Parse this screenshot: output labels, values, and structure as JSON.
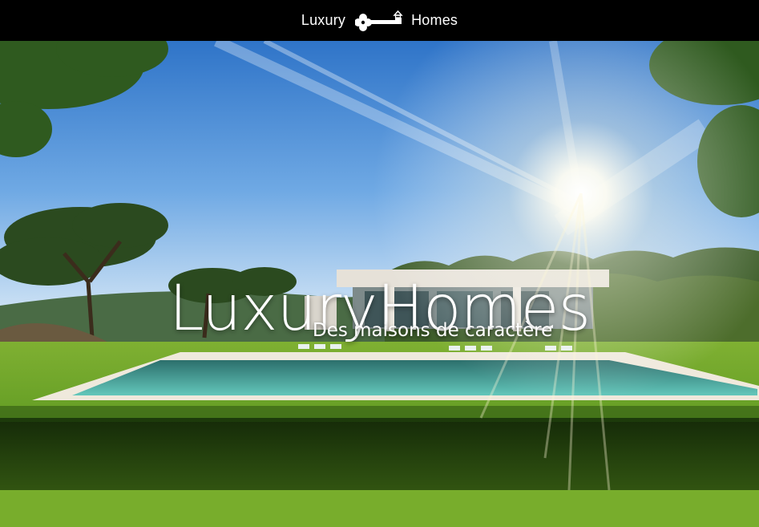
{
  "header": {
    "brand_left": "Luxury",
    "brand_right": "Homes",
    "logo_icon": "key-house-icon"
  },
  "hero": {
    "title": "LuxuryHomes",
    "subtitle": "Des maisons de caractère",
    "background": "villa-with-pool-sunburst-photo"
  },
  "colors": {
    "header_bg": "#000000",
    "text": "#ffffff",
    "sky": "#3f86d6",
    "lawn": "#5f9a22",
    "pool": "#4fb9b0"
  }
}
